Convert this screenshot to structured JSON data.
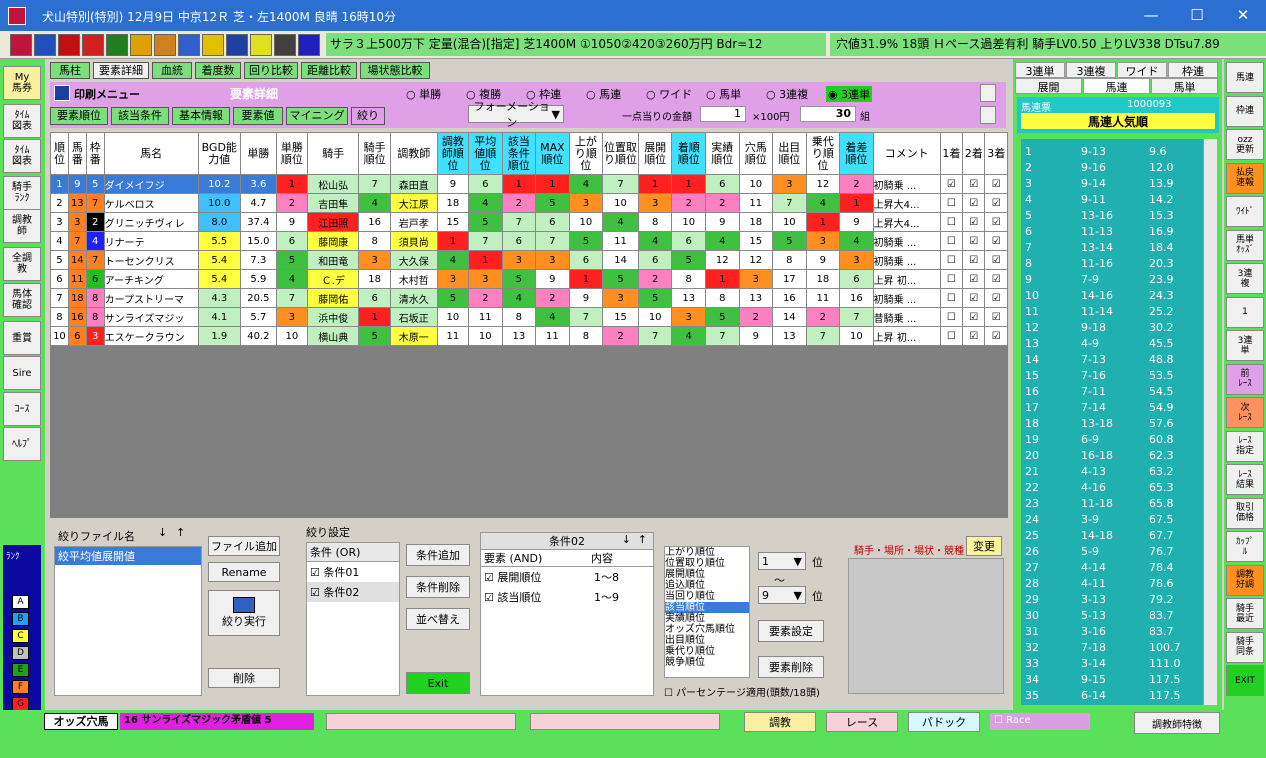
{
  "window": {
    "title": "犬山特別(特別)  12月9日  中京12Ｒ 芝・左1400M 良晴 16時10分",
    "min": "—",
    "max": "☐",
    "close": "✕"
  },
  "status": {
    "race_info": "サラ３上500万下  定量(混合)[指定]  芝1400M ①1050②420③260万円 Bdr=12",
    "right_info": "穴値31.9% 18頭 Ｈペース過差有利 騎手LV0.50 上りLV338 DTsu7.89"
  },
  "toolbar_icons": [
    "app-icon",
    "number-icon",
    "flag-icon",
    "chart-icon",
    "star-icon",
    "horse-icon",
    "id-icon",
    "search-icon",
    "sun-icon",
    "wand-icon",
    "clock-icon",
    "timer-icon",
    "hp-icon"
  ],
  "leftnav": [
    "My\n馬券",
    "ﾀｲﾑ\n図表",
    "ﾀｲﾑ\n図表",
    "騎手\nﾗﾝｸ",
    "調教\n師",
    "全調\n教",
    "馬体\n確認",
    "重賞",
    "Sire",
    "ｺｰｽ",
    "ﾍﾙﾌﾟ"
  ],
  "rank": {
    "label": "ﾗﾝｸ",
    "items": [
      {
        "l": "A",
        "c": "#ffffff"
      },
      {
        "l": "B",
        "c": "#20a0ff"
      },
      {
        "l": "C",
        "c": "#ffff40"
      },
      {
        "l": "D",
        "c": "#c0c0c0"
      },
      {
        "l": "E",
        "c": "#20a020"
      },
      {
        "l": "F",
        "c": "#ff8020"
      },
      {
        "l": "G",
        "c": "#ff2020"
      }
    ]
  },
  "tabs": [
    "馬柱",
    "要素詳細",
    "血統",
    "着度数",
    "回り比較",
    "距離比較",
    "場状態比較"
  ],
  "menu": {
    "label": "印刷メニュー",
    "title": "要素詳細"
  },
  "subtabs": [
    "要素順位",
    "該当条件",
    "基本情報",
    "要素値",
    "マイニング",
    "絞り"
  ],
  "bet_types": [
    "単勝",
    "複勝",
    "枠連",
    "馬連",
    "ワイド",
    "馬単",
    "3連複",
    "3連単"
  ],
  "selected_bet": "3連単",
  "formation": "フォーメーション",
  "amount": {
    "label": "一点当りの金額",
    "value": "1",
    "unit": "×100円",
    "count": "30",
    "count_unit": "組"
  },
  "columns": [
    "順位",
    "馬番",
    "枠番",
    "馬名",
    "BGD能力値",
    "単勝",
    "単勝順位",
    "騎手",
    "騎手順位",
    "調教師",
    "調教師順位",
    "平均値順位",
    "該当条件順位",
    "MAX順位",
    "上がり順位",
    "位置取り順位",
    "展開順位",
    "着順順位",
    "実績順位",
    "穴馬順位",
    "出目順位",
    "乗代り順位",
    "着差順位",
    "コメント",
    "1着",
    "2着",
    "3着"
  ],
  "rows": [
    [
      "1",
      "9",
      "5",
      "ダイメイフジ",
      "10.2",
      "3.6",
      "1",
      "松山弘",
      "7",
      "森田直",
      "9",
      "6",
      "1",
      "1",
      "4",
      "7",
      "1",
      "1",
      "6",
      "10",
      "3",
      "12",
      "2",
      "初騎乗 ..."
    ],
    [
      "2",
      "13",
      "7",
      "ケルベロス",
      "10.0",
      "4.7",
      "2",
      "吉田隼",
      "4",
      "大江原",
      "18",
      "4",
      "2",
      "5",
      "3",
      "10",
      "3",
      "2",
      "2",
      "11",
      "7",
      "4",
      "1",
      "上昇大4..."
    ],
    [
      "3",
      "3",
      "2",
      "グリニッチヴィレ",
      "8.0",
      "37.4",
      "9",
      "江田照",
      "16",
      "岩戸孝",
      "15",
      "5",
      "7",
      "6",
      "10",
      "4",
      "8",
      "10",
      "9",
      "18",
      "10",
      "1",
      "9",
      "上昇大4..."
    ],
    [
      "4",
      "7",
      "4",
      "リナーテ",
      "5.5",
      "15.0",
      "6",
      "藤岡康",
      "8",
      "須貝尚",
      "1",
      "7",
      "6",
      "7",
      "5",
      "11",
      "4",
      "6",
      "4",
      "15",
      "5",
      "3",
      "4",
      "初騎乗 ..."
    ],
    [
      "5",
      "14",
      "7",
      "トーセンクリス",
      "5.4",
      "7.3",
      "5",
      "和田竜",
      "3",
      "大久保",
      "4",
      "1",
      "3",
      "3",
      "6",
      "14",
      "6",
      "5",
      "12",
      "12",
      "8",
      "9",
      "3",
      "初騎乗 ..."
    ],
    [
      "6",
      "11",
      "6",
      "アーチキング",
      "5.4",
      "5.9",
      "4",
      "Ｃ.デ",
      "18",
      "木村哲",
      "3",
      "3",
      "5",
      "9",
      "1",
      "5",
      "2",
      "8",
      "1",
      "3",
      "17",
      "18",
      "6",
      "上昇 初..."
    ],
    [
      "7",
      "18",
      "8",
      "カープストリーマ",
      "4.3",
      "20.5",
      "7",
      "藤岡佑",
      "6",
      "清水久",
      "5",
      "2",
      "4",
      "2",
      "9",
      "3",
      "5",
      "13",
      "8",
      "13",
      "16",
      "11",
      "16",
      "初騎乗 ..."
    ],
    [
      "8",
      "16",
      "8",
      "サンライズマジッ",
      "4.1",
      "5.7",
      "3",
      "浜中俊",
      "1",
      "石坂正",
      "10",
      "11",
      "8",
      "4",
      "7",
      "15",
      "10",
      "3",
      "5",
      "2",
      "14",
      "2",
      "7",
      "昔騎乗 ..."
    ],
    [
      "10",
      "6",
      "3",
      "エスケークラウン",
      "1.9",
      "40.2",
      "10",
      "横山典",
      "5",
      "木原一",
      "11",
      "10",
      "13",
      "11",
      "8",
      "2",
      "7",
      "4",
      "7",
      "9",
      "13",
      "7",
      "10",
      "上昇 初..."
    ]
  ],
  "checks": [
    [
      true,
      true,
      true
    ],
    [
      false,
      true,
      true
    ],
    [
      false,
      true,
      true
    ],
    [
      false,
      true,
      true
    ],
    [
      false,
      true,
      true
    ],
    [
      false,
      true,
      true
    ],
    [
      false,
      true,
      true
    ],
    [
      false,
      true,
      true
    ],
    [
      false,
      true,
      true
    ]
  ],
  "filter_file": {
    "label": "絞りファイル名",
    "items": [
      "絞平均値展開値"
    ],
    "buttons": [
      "ファイル追加",
      "Rename",
      "絞り実行",
      "削除"
    ]
  },
  "filter_settings": {
    "label": "絞り設定",
    "cond_label": "条件 (OR)",
    "conds": [
      "条件01",
      "条件02"
    ],
    "buttons": [
      "条件追加",
      "条件削除",
      "並べ替え",
      "Exit"
    ]
  },
  "cond_detail": {
    "label": "条件02",
    "col1": "要素 (AND)",
    "col2": "内容",
    "items": [
      {
        "name": "展開順位",
        "range": "1〜8"
      },
      {
        "name": "該当順位",
        "range": "1〜9"
      }
    ]
  },
  "elements": [
    "上がり順位",
    "位置取り順位",
    "展開順位",
    "追込順位",
    "当回り順位",
    "該当順位",
    "実績順位",
    "オッズ穴馬順位",
    "出目順位",
    "乗代り順位",
    "競争順位"
  ],
  "selected_element": "該当順位",
  "range_from": "1",
  "range_to": "9",
  "range_unit": "位",
  "tilde": "〜",
  "range_buttons": [
    "要素設定",
    "要素削除"
  ],
  "percent_label": "パーセンテージ適用(頭数/18頭)",
  "jockey_label": "騎手・場所・場状・競種",
  "change": "変更",
  "odds_tabs_top": [
    "3連単",
    "3連複",
    "ワイド",
    "枠連"
  ],
  "odds_tabs_bottom": [
    "展開",
    "馬連",
    "馬単"
  ],
  "odds_header": {
    "label": "馬連票",
    "id": "1000093",
    "title": "馬連人気順"
  },
  "odds": [
    [
      "1",
      "9-13",
      "9.6"
    ],
    [
      "2",
      "9-16",
      "12.0"
    ],
    [
      "3",
      "9-14",
      "13.9"
    ],
    [
      "4",
      "9-11",
      "14.2"
    ],
    [
      "5",
      "13-16",
      "15.3"
    ],
    [
      "6",
      "11-13",
      "16.9"
    ],
    [
      "7",
      "13-14",
      "18.4"
    ],
    [
      "8",
      "11-16",
      "20.3"
    ],
    [
      "9",
      "7-9",
      "23.9"
    ],
    [
      "10",
      "14-16",
      "24.3"
    ],
    [
      "11",
      "11-14",
      "25.2"
    ],
    [
      "12",
      "9-18",
      "30.2"
    ],
    [
      "13",
      "4-9",
      "45.5"
    ],
    [
      "14",
      "7-13",
      "48.8"
    ],
    [
      "15",
      "7-16",
      "53.5"
    ],
    [
      "16",
      "7-11",
      "54.5"
    ],
    [
      "17",
      "7-14",
      "54.9"
    ],
    [
      "18",
      "13-18",
      "57.6"
    ],
    [
      "19",
      "6-9",
      "60.8"
    ],
    [
      "20",
      "16-18",
      "62.3"
    ],
    [
      "21",
      "4-13",
      "63.2"
    ],
    [
      "22",
      "4-16",
      "65.3"
    ],
    [
      "23",
      "11-18",
      "65.8"
    ],
    [
      "24",
      "3-9",
      "67.5"
    ],
    [
      "25",
      "14-18",
      "67.7"
    ],
    [
      "26",
      "5-9",
      "76.7"
    ],
    [
      "27",
      "4-14",
      "78.4"
    ],
    [
      "28",
      "4-11",
      "78.6"
    ],
    [
      "29",
      "3-13",
      "79.2"
    ],
    [
      "30",
      "5-13",
      "83.7"
    ],
    [
      "31",
      "3-16",
      "83.7"
    ],
    [
      "32",
      "7-18",
      "100.7"
    ],
    [
      "33",
      "3-14",
      "111.0"
    ],
    [
      "34",
      "9-15",
      "117.5"
    ],
    [
      "35",
      "6-14",
      "117.5"
    ]
  ],
  "rightnav": [
    "馬連",
    "枠連",
    "ozz\n更新",
    "払戻\n速報",
    "ﾜｲﾄﾞ",
    "馬単\nｵｯｽﾞ",
    "3連\n複",
    "1",
    "3連\n単",
    "前\nﾚｰｽ",
    "次\nﾚｰｽ",
    "ﾚｰｽ\n指定",
    "ﾚｰｽ\n結果",
    "取引\n価格",
    "ｶｯﾌﾟ\nﾙ",
    "調教\n好調",
    "騎手\n最近",
    "騎手\n同条",
    "EXIT"
  ],
  "bottom": {
    "odds_label": "オッズ穴馬",
    "odds_value": "16 サンライズマジック矛盾値  5",
    "buttons": [
      "調教",
      "レース",
      "パドック"
    ],
    "race_check": "Race",
    "trainer_btn": "調教師特徴"
  }
}
